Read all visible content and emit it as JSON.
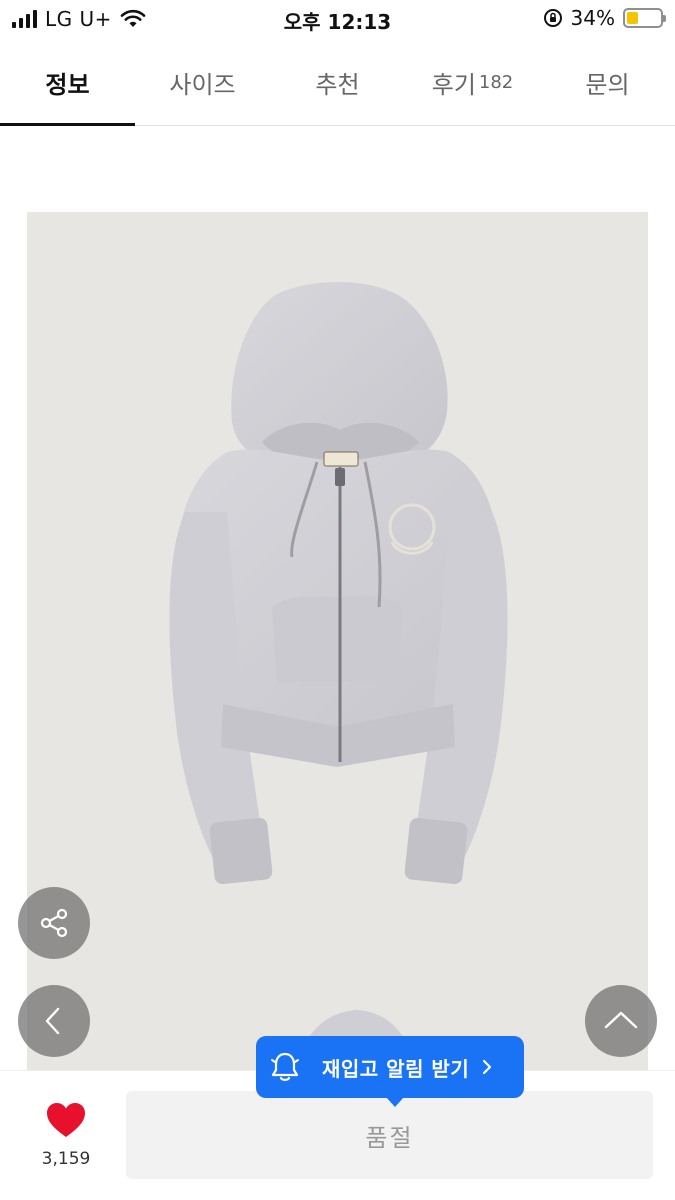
{
  "status_bar": {
    "carrier": "LG U+",
    "time": "오후 12:13",
    "battery_percent": "34%",
    "battery_level": 0.34,
    "icons": [
      "signal-icon",
      "wifi-icon",
      "orientation-lock-icon",
      "battery-icon"
    ]
  },
  "tabs": [
    {
      "label": "정보",
      "active": true
    },
    {
      "label": "사이즈",
      "active": false
    },
    {
      "label": "추천",
      "active": false
    },
    {
      "label": "후기",
      "count": "182",
      "active": false
    },
    {
      "label": "문의",
      "active": false
    }
  ],
  "product": {
    "image_subject": "hoodie-zip-up"
  },
  "floating_buttons": {
    "share": "share-icon",
    "back": "chevron-left-icon",
    "top": "chevron-up-icon"
  },
  "restock": {
    "label": "재입고 알림 받기",
    "icon": "bell-icon",
    "color": "#1a73f5"
  },
  "bottom_bar": {
    "like_count": "3,159",
    "like_icon": "heart-icon",
    "like_color": "#e8112d",
    "soldout_label": "품절"
  }
}
